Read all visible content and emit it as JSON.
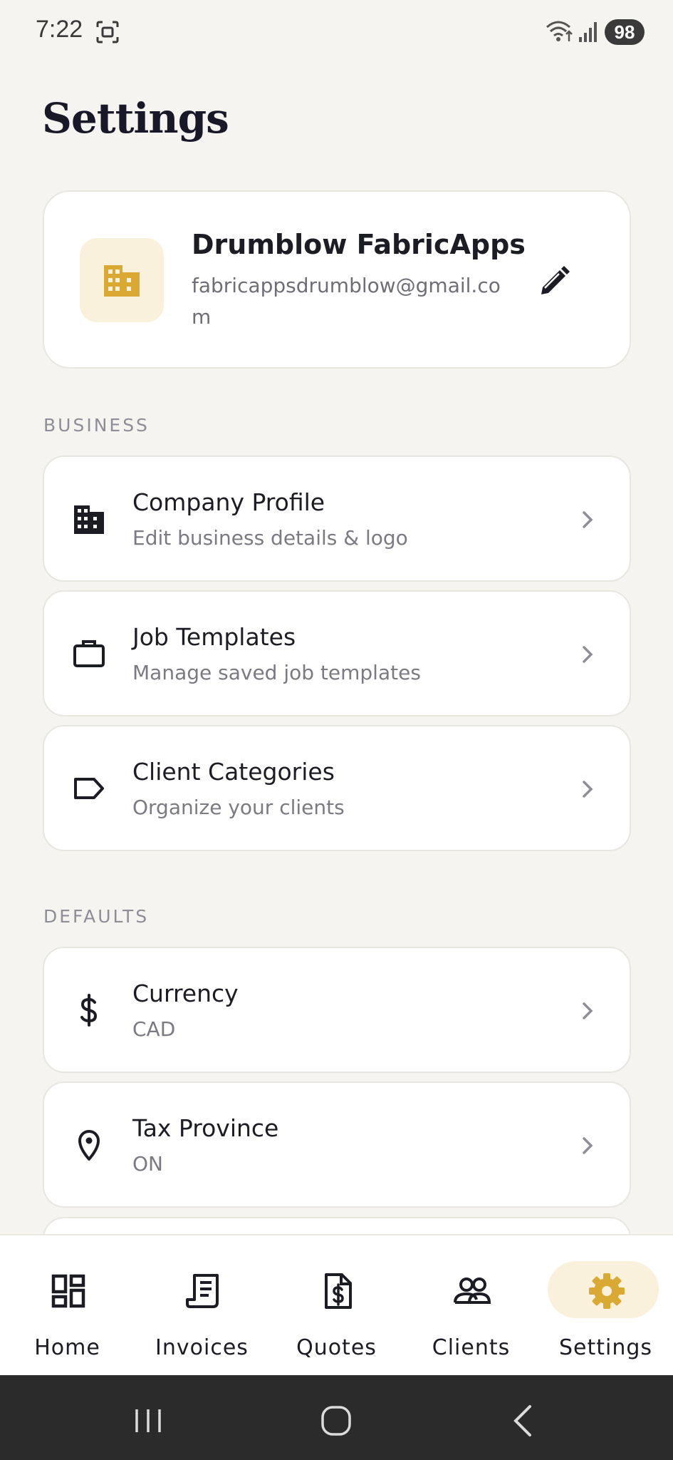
{
  "status_bar": {
    "time": "7:22",
    "battery": "98"
  },
  "page": {
    "title": "Settings"
  },
  "profile": {
    "name": "Drumblow FabricApps",
    "email": "fabricappsdrumblow@gmail.com",
    "avatar_icon": "building-icon",
    "edit_icon": "pencil-icon"
  },
  "sections": {
    "business": {
      "header": "BUSINESS",
      "items": [
        {
          "title": "Company Profile",
          "subtitle": "Edit business details & logo",
          "icon": "building-icon"
        },
        {
          "title": "Job Templates",
          "subtitle": "Manage saved job templates",
          "icon": "briefcase-icon"
        },
        {
          "title": "Client Categories",
          "subtitle": "Organize your clients",
          "icon": "tag-icon"
        }
      ]
    },
    "defaults": {
      "header": "DEFAULTS",
      "items": [
        {
          "title": "Currency",
          "subtitle": "CAD",
          "icon": "dollar-icon"
        },
        {
          "title": "Tax Province",
          "subtitle": "ON",
          "icon": "location-pin-icon"
        }
      ]
    }
  },
  "bottom_nav": {
    "items": [
      {
        "label": "Home",
        "icon": "dashboard-icon"
      },
      {
        "label": "Invoices",
        "icon": "receipt-icon"
      },
      {
        "label": "Quotes",
        "icon": "dollar-document-icon"
      },
      {
        "label": "Clients",
        "icon": "people-icon"
      },
      {
        "label": "Settings",
        "icon": "gear-icon"
      }
    ],
    "active": "Settings"
  },
  "colors": {
    "background": "#f5f4f0",
    "accent": "#d9a934",
    "accent_soft": "#faf1dc",
    "text_primary": "#1c1c24",
    "text_secondary": "#7a7a82"
  }
}
